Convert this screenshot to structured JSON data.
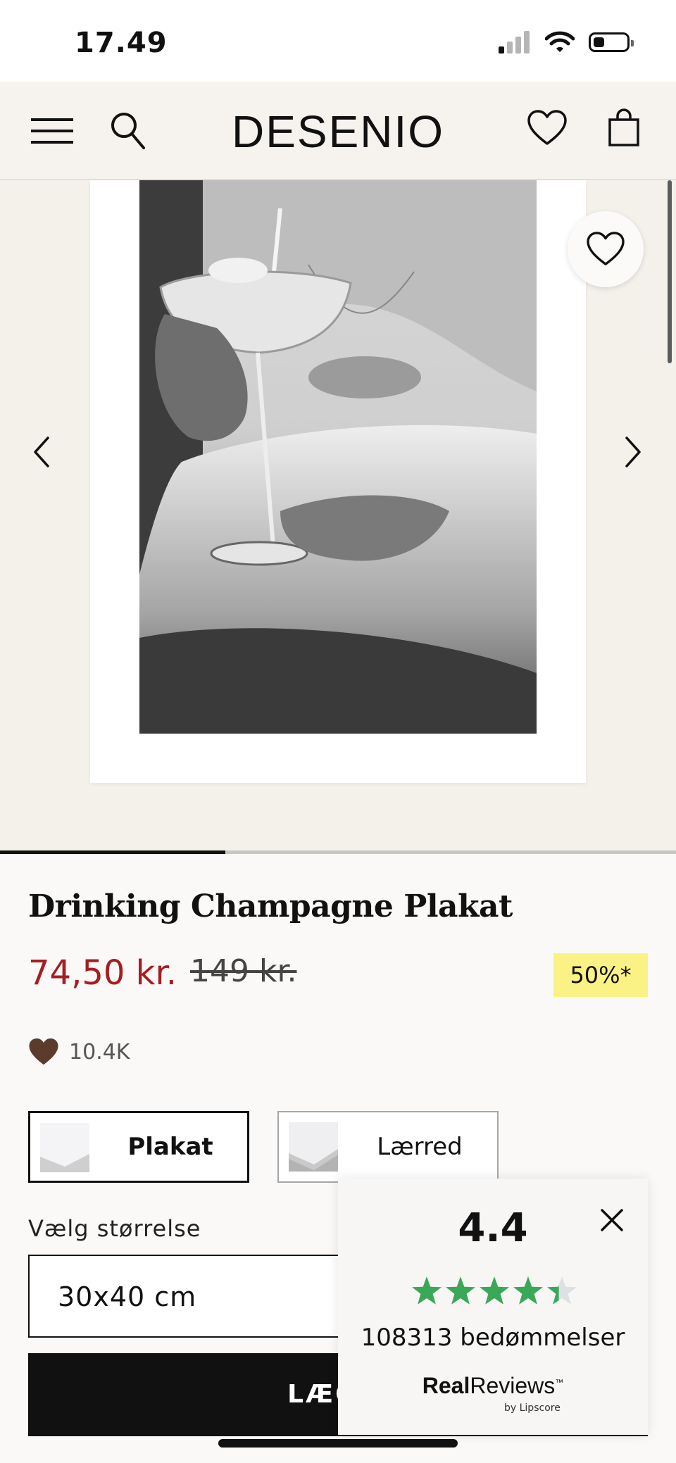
{
  "status_bar": {
    "time": "17.49",
    "battery_level": 0.35
  },
  "header": {
    "logo": "DESENIO"
  },
  "gallery": {
    "current_slide": 1,
    "total_slides": 3
  },
  "product": {
    "title": "Drinking Champagne Plakat",
    "price": "74,50 kr.",
    "original_price": "149 kr.",
    "discount_badge": "50%*",
    "likes": "10.4K"
  },
  "formats": [
    {
      "label": "Plakat",
      "selected": true
    },
    {
      "label": "Lærred",
      "selected": false
    }
  ],
  "size": {
    "label": "Vælg størrelse",
    "value": "30x40 cm"
  },
  "cart_button": {
    "label": "LÆG T"
  },
  "reviews": {
    "score": "4.4",
    "rating": 4.4,
    "count_text": "108313 bedømmelser",
    "brand_primary": "Real",
    "brand_secondary": "Reviews",
    "brand_tm": "™",
    "brand_sub": "by Lipscore"
  },
  "colors": {
    "price_red": "#a61d22",
    "discount_yellow": "#fbf285",
    "star_green": "#3aa856",
    "heart_brown": "#5a3b2c"
  },
  "icons": [
    "menu-icon",
    "search-icon",
    "heart-icon",
    "bag-icon",
    "chevron-left-icon",
    "chevron-right-icon",
    "close-icon",
    "star-icon",
    "wifi-icon",
    "signal-icon",
    "battery-icon"
  ]
}
